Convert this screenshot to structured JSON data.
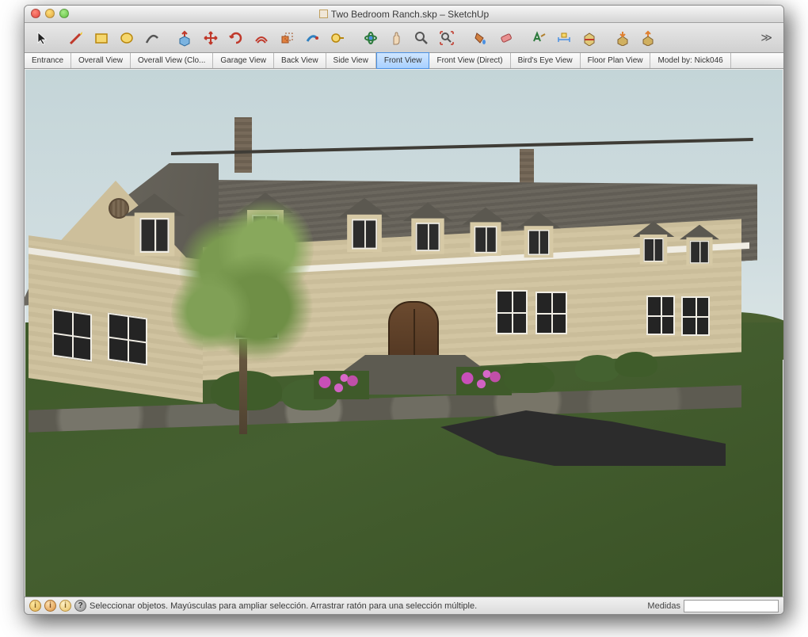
{
  "window": {
    "title": "Two Bedroom Ranch.skp – SketchUp"
  },
  "toolbar": {
    "tools": [
      {
        "name": "select",
        "hint": "Select"
      },
      {
        "name": "line",
        "hint": "Line"
      },
      {
        "name": "rectangle",
        "hint": "Rectangle"
      },
      {
        "name": "circle",
        "hint": "Circle"
      },
      {
        "name": "arc",
        "hint": "Arc"
      },
      {
        "name": "push-pull",
        "hint": "Push/Pull"
      },
      {
        "name": "move",
        "hint": "Move"
      },
      {
        "name": "rotate",
        "hint": "Rotate"
      },
      {
        "name": "offset",
        "hint": "Offset"
      },
      {
        "name": "scale",
        "hint": "Scale"
      },
      {
        "name": "follow-me",
        "hint": "Follow Me"
      },
      {
        "name": "tape",
        "hint": "Tape Measure"
      },
      {
        "name": "orbit",
        "hint": "Orbit"
      },
      {
        "name": "pan",
        "hint": "Pan"
      },
      {
        "name": "zoom",
        "hint": "Zoom"
      },
      {
        "name": "zoom-extents",
        "hint": "Zoom Extents"
      },
      {
        "name": "paint",
        "hint": "Paint Bucket"
      },
      {
        "name": "eraser",
        "hint": "Eraser"
      },
      {
        "name": "text",
        "hint": "Text"
      },
      {
        "name": "dimension",
        "hint": "Dimension"
      },
      {
        "name": "section",
        "hint": "Section Plane"
      },
      {
        "name": "get-models",
        "hint": "Get Models"
      },
      {
        "name": "share",
        "hint": "Share Model"
      }
    ]
  },
  "scenes": {
    "tabs": [
      {
        "label": "Entrance",
        "active": false
      },
      {
        "label": "Overall View",
        "active": false
      },
      {
        "label": "Overall View (Clo...",
        "active": false
      },
      {
        "label": "Garage View",
        "active": false
      },
      {
        "label": "Back View",
        "active": false
      },
      {
        "label": "Side View",
        "active": false
      },
      {
        "label": "Front View",
        "active": true
      },
      {
        "label": "Front View (Direct)",
        "active": false
      },
      {
        "label": "Bird's Eye View",
        "active": false
      },
      {
        "label": "Floor Plan View",
        "active": false
      },
      {
        "label": "Model by: Nick046",
        "active": false
      }
    ]
  },
  "status": {
    "hint": "Seleccionar objetos. Mayúsculas para ampliar selección. Arrastrar ratón para una selección múltiple.",
    "measure_label": "Medidas",
    "measure_value": ""
  }
}
